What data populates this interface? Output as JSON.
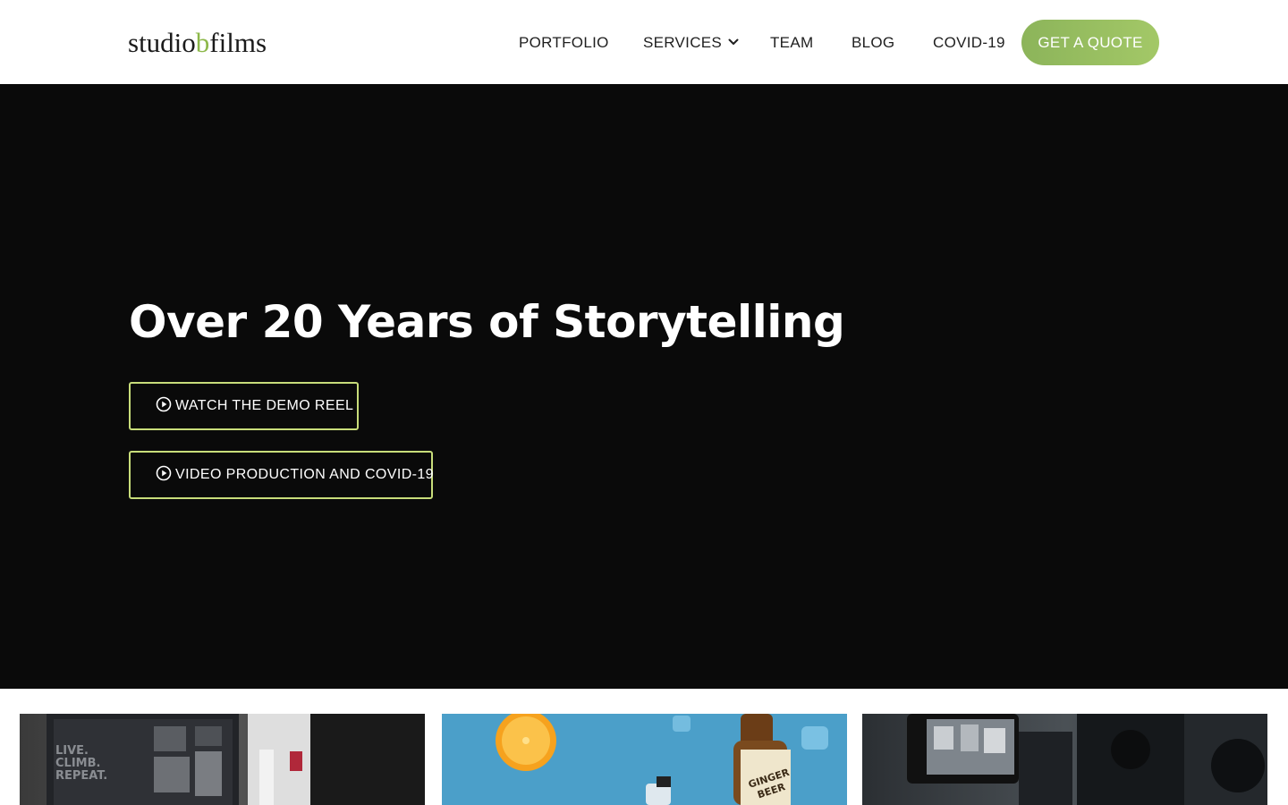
{
  "header": {
    "logo": {
      "part1": "studio",
      "part2": "b",
      "part3": "films"
    },
    "nav": {
      "portfolio": "PORTFOLIO",
      "services": "SERVICES",
      "team": "TEAM",
      "blog": "BLOG",
      "covid": "COVID-19"
    },
    "quote_button": "GET A QUOTE"
  },
  "hero": {
    "title": "Over 20 Years of Storytelling",
    "buttons": {
      "demo_reel": "WATCH THE DEMO REEL",
      "video_covid": "VIDEO PRODUCTION AND COVID-19"
    }
  },
  "thumbnails": {
    "t1_text": [
      "LIVE.",
      "CLIMB.",
      "REPEAT."
    ],
    "t2_bottle_label": [
      "GINGER",
      "BEER"
    ]
  },
  "colors": {
    "accent_green": "#8db84a",
    "button_border": "#c8dd7a",
    "hero_bg": "#0a0a0a"
  },
  "icons": {
    "services_dropdown": "chevron-down-icon",
    "hero_buttons": "play-circle-icon"
  }
}
